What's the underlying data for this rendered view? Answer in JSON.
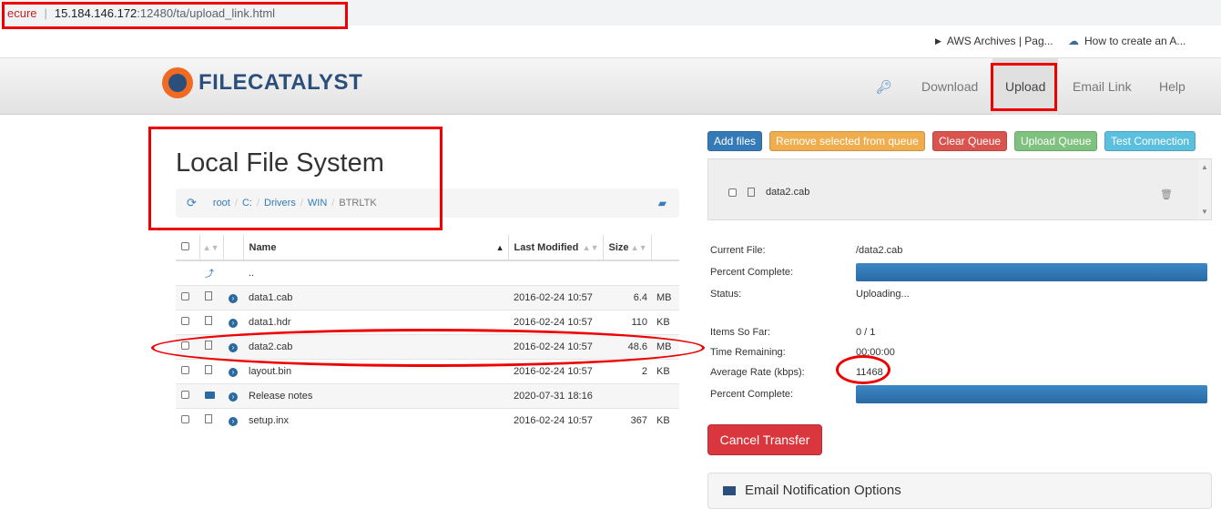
{
  "browser": {
    "secure_label": "ecure",
    "url_host": "15.184.146.172",
    "url_rest": ":12480/ta/upload_link.html",
    "bookmarks": [
      "AWS Archives | Pag...",
      "How to create an A..."
    ]
  },
  "header": {
    "logo_text": "FILECATALYST",
    "nav": [
      "Download",
      "Upload",
      "Email Link",
      "Help"
    ],
    "active_nav": "Upload"
  },
  "local": {
    "title": "Local File System",
    "breadcrumb": [
      "root",
      "C:",
      "Drivers",
      "WIN",
      "BTRLTK"
    ],
    "columns": [
      "Name",
      "Last Modified",
      "Size"
    ],
    "up_label": "..",
    "files": [
      {
        "name": "data1.cab",
        "modified": "2016-02-24 10:57",
        "size": "6.4",
        "unit": "MB",
        "type": "file"
      },
      {
        "name": "data1.hdr",
        "modified": "2016-02-24 10:57",
        "size": "110",
        "unit": "KB",
        "type": "file"
      },
      {
        "name": "data2.cab",
        "modified": "2016-02-24 10:57",
        "size": "48.6",
        "unit": "MB",
        "type": "file"
      },
      {
        "name": "layout.bin",
        "modified": "2016-02-24 10:57",
        "size": "2",
        "unit": "KB",
        "type": "file"
      },
      {
        "name": "Release notes",
        "modified": "2020-07-31 18:16",
        "size": "",
        "unit": "",
        "type": "folder"
      },
      {
        "name": "setup.inx",
        "modified": "2016-02-24 10:57",
        "size": "367",
        "unit": "KB",
        "type": "file"
      }
    ]
  },
  "queue": {
    "buttons": {
      "add": "Add files",
      "remove": "Remove selected from queue",
      "clear": "Clear Queue",
      "upload": "Upload Queue",
      "test": "Test Connection"
    },
    "items": [
      "data2.cab"
    ]
  },
  "transfer": {
    "current_file_label": "Current File:",
    "current_file": "/data2.cab",
    "percent_label": "Percent Complete:",
    "status_label": "Status:",
    "status": "Uploading...",
    "items_label": "Items So Far:",
    "items": "0 / 1",
    "time_label": "Time Remaining:",
    "time": "00:00:00",
    "rate_label": "Average Rate (kbps):",
    "rate": "11468",
    "overall_label": "Percent Complete:",
    "file_progress": 1.0,
    "overall_progress": 1.0
  },
  "actions": {
    "cancel": "Cancel Transfer",
    "email_options": "Email Notification Options"
  },
  "colors": {
    "add": "#337ab7",
    "remove": "#f0ad4e",
    "clear": "#d9534f",
    "upload": "#7fc27f",
    "test": "#5bc0de"
  }
}
